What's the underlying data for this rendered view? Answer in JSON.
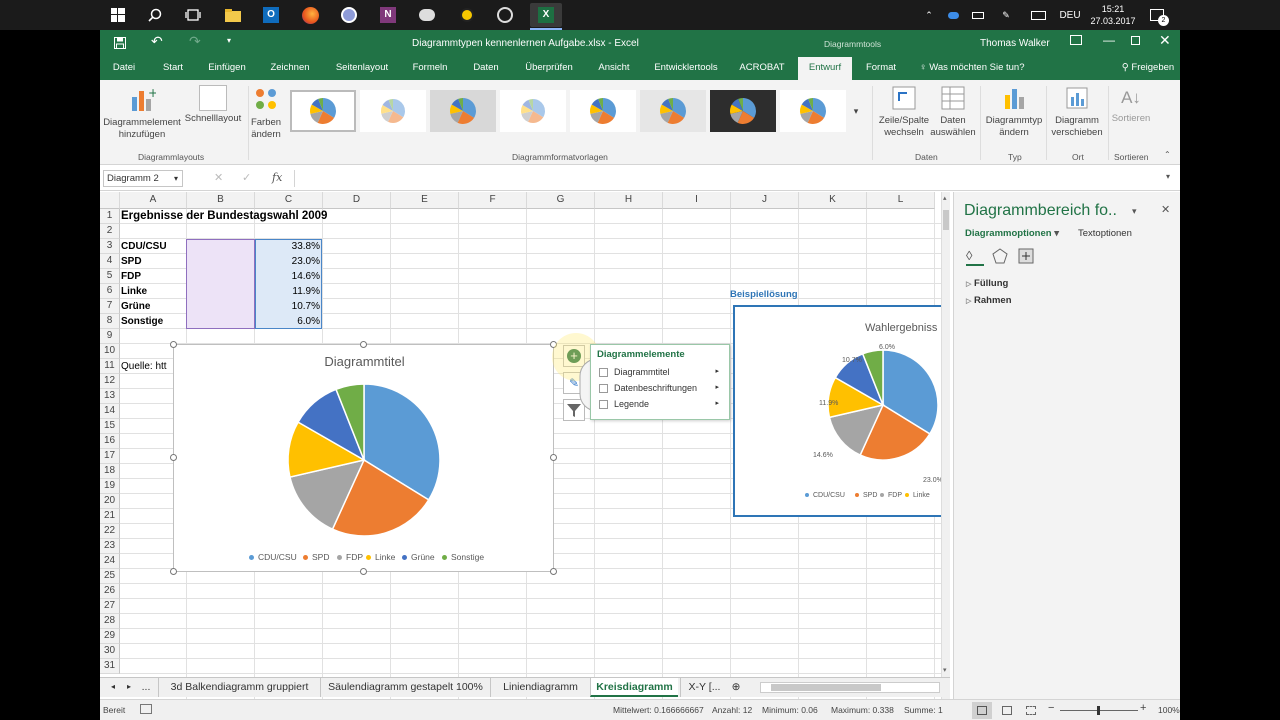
{
  "taskbar": {
    "icons": [
      "windows-start-icon",
      "search-icon",
      "task-view-icon",
      "file-explorer-icon",
      "outlook-icon",
      "firefox-icon",
      "keepass-icon",
      "onenote-icon",
      "app-icon",
      "app-yellow-icon",
      "app-circle-icon",
      "excel-icon"
    ],
    "lang": "DEU",
    "time": "15:21",
    "date": "27.03.2017",
    "notif_count": "2"
  },
  "window": {
    "title": "Diagrammtypen kennenlernen Aufgabe.xlsx  -  Excel",
    "contextual": "Diagrammtools",
    "user": "Thomas Walker"
  },
  "tabs": [
    "Datei",
    "Start",
    "Einfügen",
    "Zeichnen",
    "Seitenlayout",
    "Formeln",
    "Daten",
    "Überprüfen",
    "Ansicht",
    "Entwicklertools",
    "ACROBAT",
    "Entwurf",
    "Format"
  ],
  "tell_me": "Was möchten Sie tun?",
  "share": "Freigeben",
  "ribbon": {
    "add_element": "Diagrammelement hinzufügen",
    "quick_layout": "Schnelllayout",
    "colors": "Farben ändern",
    "switch": "Zeile/Spalte wechseln",
    "select_data": "Daten auswählen",
    "change_type": "Diagrammtyp ändern",
    "move": "Diagramm verschieben",
    "sort": "Sortieren",
    "groups": {
      "layouts": "Diagrammlayouts",
      "styles": "Diagrammformatvorlagen",
      "data": "Daten",
      "type": "Typ",
      "loc": "Ort",
      "sort": "Sortieren"
    }
  },
  "formula": {
    "name_box": "Diagramm 2",
    "fx": "fx"
  },
  "columns": [
    "A",
    "B",
    "C",
    "D",
    "E",
    "F",
    "G",
    "H",
    "I",
    "J",
    "K",
    "L"
  ],
  "rows": [
    "1",
    "2",
    "3",
    "4",
    "5",
    "6",
    "7",
    "8",
    "9",
    "10",
    "11",
    "12",
    "13",
    "14",
    "15",
    "16",
    "17",
    "18",
    "19",
    "20",
    "21",
    "22",
    "23",
    "24",
    "25",
    "26",
    "27",
    "28",
    "29",
    "30",
    "31"
  ],
  "sheet": {
    "title": "Ergebnisse der Bundestagswahl 2009",
    "source": "Quelle: htt",
    "data": [
      {
        "party": "CDU/CSU",
        "value": "33.8%"
      },
      {
        "party": "SPD",
        "value": "23.0%"
      },
      {
        "party": "FDP",
        "value": "14.6%"
      },
      {
        "party": "Linke",
        "value": "11.9%"
      },
      {
        "party": "Grüne",
        "value": "10.7%"
      },
      {
        "party": "Sonstige",
        "value": "6.0%"
      }
    ],
    "example_label": "Beispiellösung"
  },
  "chart_data": [
    {
      "type": "pie",
      "title": "Diagrammtitel",
      "categories": [
        "CDU/CSU",
        "SPD",
        "FDP",
        "Linke",
        "Grüne",
        "Sonstige"
      ],
      "values": [
        33.8,
        23.0,
        14.6,
        11.9,
        10.7,
        6.0
      ],
      "colors": [
        "#5b9bd5",
        "#ed7d31",
        "#a5a5a5",
        "#ffc000",
        "#4472c4",
        "#70ad47"
      ],
      "legend": "bottom"
    },
    {
      "type": "pie",
      "title": "Wahlergebniss",
      "categories": [
        "CDU/CSU",
        "SPD",
        "FDP",
        "Linke"
      ],
      "values": [
        33.8,
        23.0,
        14.6,
        11.9,
        10.7,
        6.0
      ],
      "data_labels": [
        "23.0%",
        "14.6%",
        "11.9%",
        "10.7%",
        "6.0%"
      ],
      "colors": [
        "#5b9bd5",
        "#ed7d31",
        "#a5a5a5",
        "#ffc000",
        "#4472c4",
        "#70ad47"
      ],
      "legend": "bottom"
    }
  ],
  "popup": {
    "title": "Diagrammelemente",
    "items": [
      "Diagrammtitel",
      "Datenbeschriftungen",
      "Legende"
    ]
  },
  "pane": {
    "title": "Diagrammbereich fo..",
    "tab1": "Diagrammoptionen",
    "tab2": "Textoptionen",
    "section1": "Füllung",
    "section2": "Rahmen"
  },
  "sheet_tabs": [
    "3d Balkendiagramm gruppiert",
    "Säulendiagramm gestapelt 100%",
    "Liniendiagramm",
    "Kreisdiagramm",
    "X-Y [..."
  ],
  "status": {
    "ready": "Bereit",
    "avg": "Mittelwert: 0.166666667",
    "count": "Anzahl: 12",
    "min": "Minimum: 0.06",
    "max": "Maximum: 0.338",
    "sum": "Summe: 1",
    "zoom": "100%"
  }
}
